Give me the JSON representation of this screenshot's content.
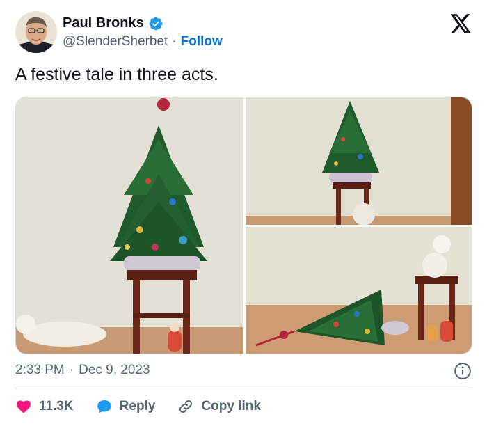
{
  "author": {
    "name": "Paul Bronks",
    "handle": "@SlenderSherbet",
    "separator": "·",
    "follow_label": "Follow",
    "verified": true
  },
  "tweet": {
    "text": "A festive tale in three acts.",
    "time": "2:33 PM",
    "date_separator": "·",
    "date": "Dec 9, 2023"
  },
  "media": [
    {
      "icon": "photo-tree-on-stool"
    },
    {
      "icon": "photo-tree-cat-under"
    },
    {
      "icon": "photo-tree-fallen-cat-on-stool"
    }
  ],
  "actions": {
    "likes": "11.3K",
    "reply_label": "Reply",
    "copy_link_label": "Copy link"
  },
  "colors": {
    "accent": "#006fd6",
    "verified": "#1d9bf0",
    "like": "#f91880",
    "reply": "#1d9bf0",
    "text_secondary": "#536471"
  }
}
